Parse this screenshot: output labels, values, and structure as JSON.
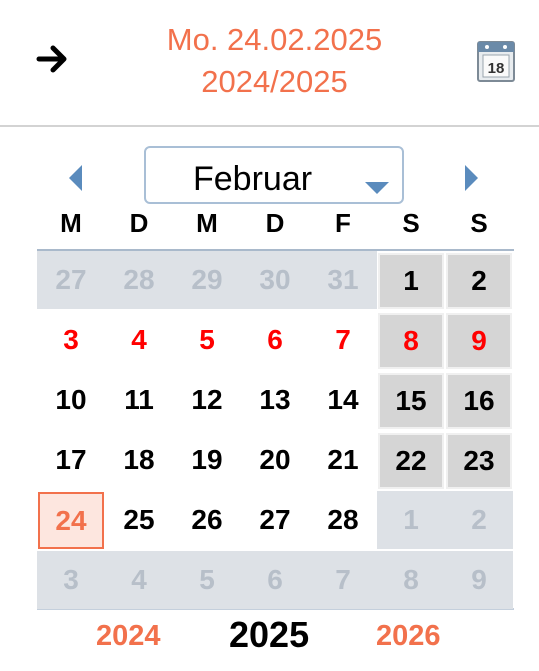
{
  "header": {
    "date_line": "Mo. 24.02.2025",
    "season_line": "2024/2025",
    "calendar_icon_day": "18"
  },
  "calendar": {
    "month": "Februar",
    "weekdays": [
      "M",
      "D",
      "M",
      "D",
      "F",
      "S",
      "S"
    ],
    "weeks": [
      [
        {
          "d": "27",
          "t": "prev"
        },
        {
          "d": "28",
          "t": "prev"
        },
        {
          "d": "29",
          "t": "prev"
        },
        {
          "d": "30",
          "t": "prev"
        },
        {
          "d": "31",
          "t": "prev"
        },
        {
          "d": "1",
          "t": "wkend"
        },
        {
          "d": "2",
          "t": "wkend"
        }
      ],
      [
        {
          "d": "3",
          "t": "holiday"
        },
        {
          "d": "4",
          "t": "holiday"
        },
        {
          "d": "5",
          "t": "holiday"
        },
        {
          "d": "6",
          "t": "holiday"
        },
        {
          "d": "7",
          "t": "holiday"
        },
        {
          "d": "8",
          "t": "holiday-wkend"
        },
        {
          "d": "9",
          "t": "holiday-wkend"
        }
      ],
      [
        {
          "d": "10",
          "t": "cur"
        },
        {
          "d": "11",
          "t": "cur"
        },
        {
          "d": "12",
          "t": "cur"
        },
        {
          "d": "13",
          "t": "cur"
        },
        {
          "d": "14",
          "t": "cur"
        },
        {
          "d": "15",
          "t": "wkend"
        },
        {
          "d": "16",
          "t": "wkend"
        }
      ],
      [
        {
          "d": "17",
          "t": "cur"
        },
        {
          "d": "18",
          "t": "cur"
        },
        {
          "d": "19",
          "t": "cur"
        },
        {
          "d": "20",
          "t": "cur"
        },
        {
          "d": "21",
          "t": "cur"
        },
        {
          "d": "22",
          "t": "wkend"
        },
        {
          "d": "23",
          "t": "wkend"
        }
      ],
      [
        {
          "d": "24",
          "t": "today"
        },
        {
          "d": "25",
          "t": "cur"
        },
        {
          "d": "26",
          "t": "cur"
        },
        {
          "d": "27",
          "t": "cur"
        },
        {
          "d": "28",
          "t": "cur"
        },
        {
          "d": "1",
          "t": "next"
        },
        {
          "d": "2",
          "t": "next"
        }
      ],
      [
        {
          "d": "3",
          "t": "next"
        },
        {
          "d": "4",
          "t": "next"
        },
        {
          "d": "5",
          "t": "next"
        },
        {
          "d": "6",
          "t": "next"
        },
        {
          "d": "7",
          "t": "next"
        },
        {
          "d": "8",
          "t": "next"
        },
        {
          "d": "9",
          "t": "next"
        }
      ]
    ]
  },
  "years": {
    "prev": "2024",
    "current": "2025",
    "next": "2026"
  },
  "colors": {
    "accent": "#f2714c",
    "holiday": "#ff0000",
    "weekend_box": "#d5d5d5",
    "outside_month_bg": "#dde1e6",
    "outside_month_text": "#b7bfc9"
  }
}
